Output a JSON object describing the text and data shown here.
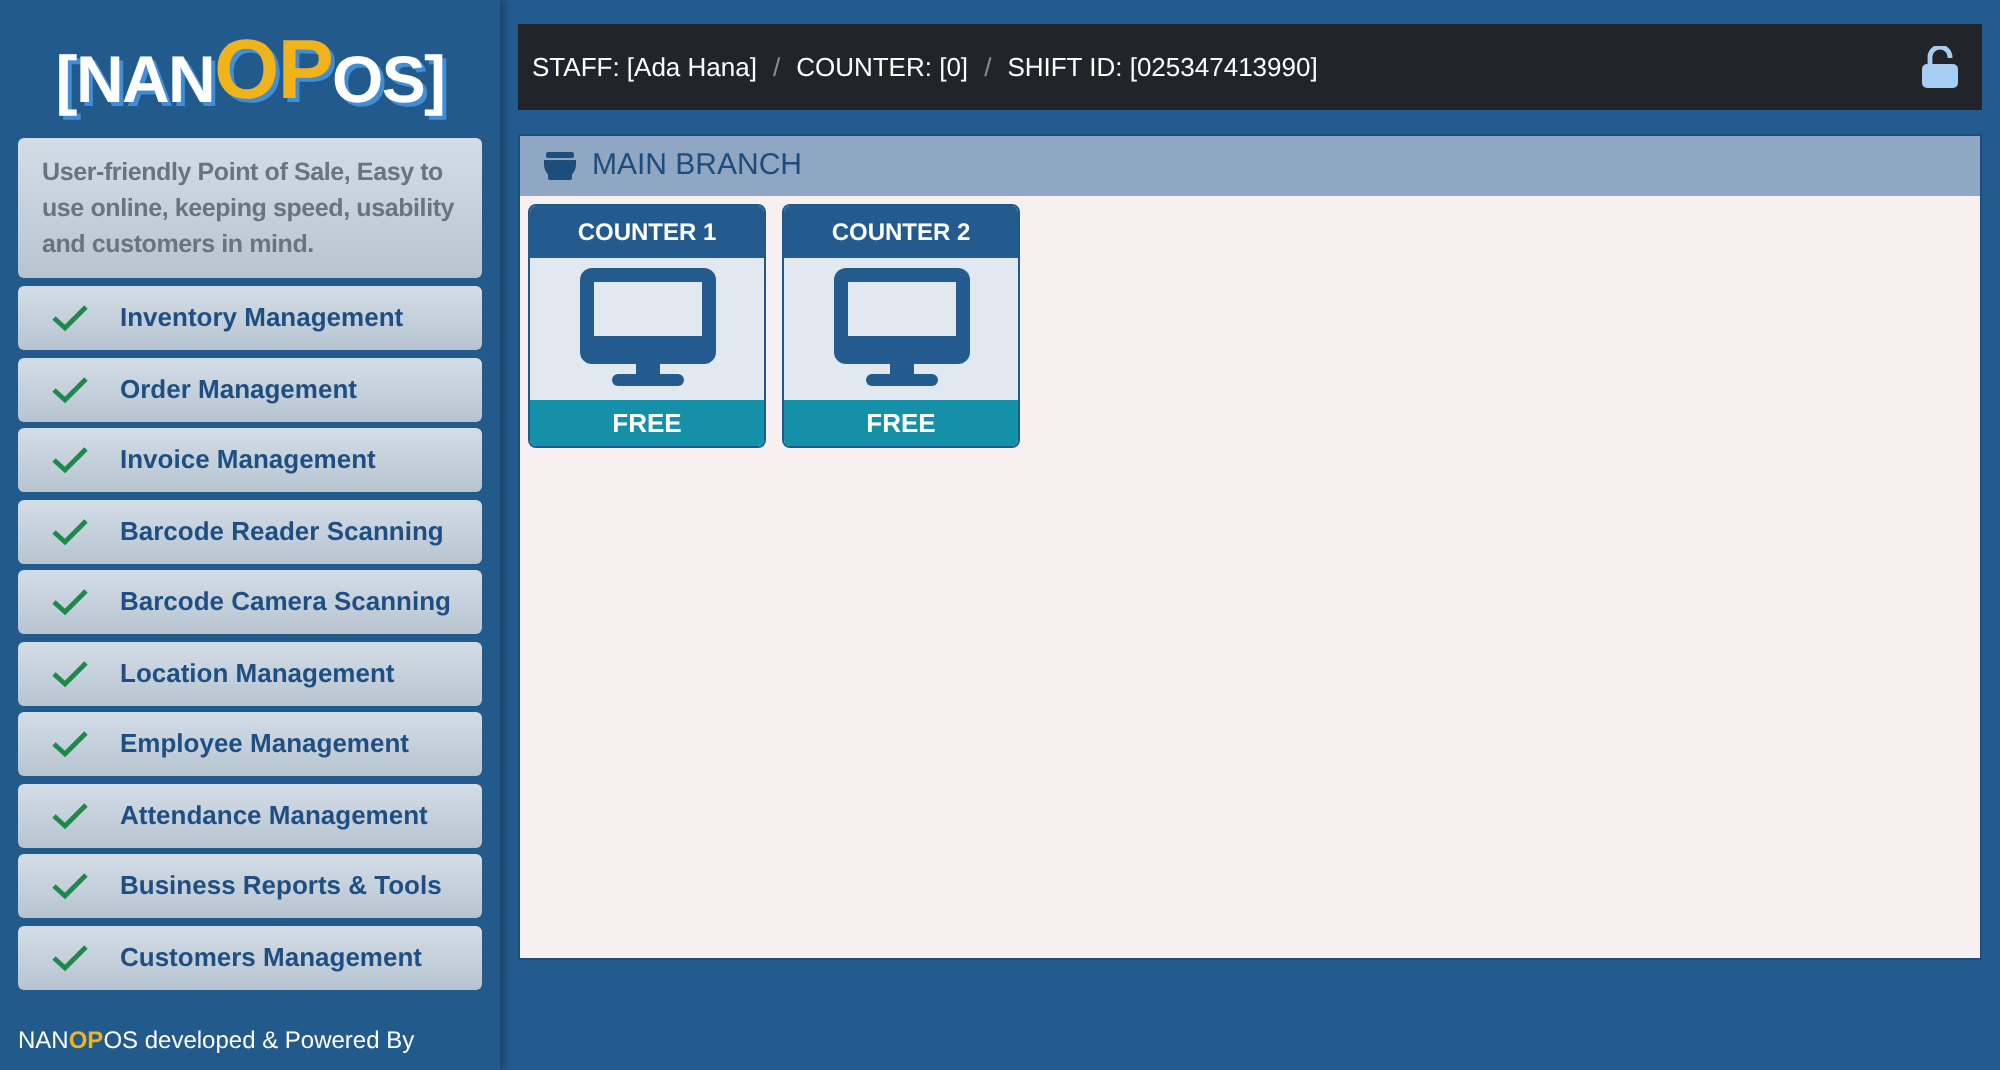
{
  "sidebar": {
    "logo": [
      {
        "text": "[NAN",
        "highlight": false
      },
      {
        "text": "OP",
        "highlight": true
      },
      {
        "text": "OS]",
        "highlight": false
      }
    ],
    "description": "User-friendly Point of Sale, Easy to use online, keeping speed, usability and customers in mind.",
    "features": [
      {
        "label": "Inventory Management",
        "checked": true
      },
      {
        "label": "Order Management",
        "checked": true
      },
      {
        "label": "Invoice Management",
        "checked": true
      },
      {
        "label": "Barcode Reader Scanning",
        "checked": true
      },
      {
        "label": "Barcode Camera Scanning",
        "checked": true
      },
      {
        "label": "Location Management",
        "checked": true
      },
      {
        "label": "Employee Management",
        "checked": true
      },
      {
        "label": "Attendance Management",
        "checked": true
      },
      {
        "label": "Business Reports & Tools",
        "checked": true
      },
      {
        "label": "Customers Management",
        "checked": true
      }
    ],
    "footer": [
      {
        "text": "NAN",
        "highlight": false
      },
      {
        "text": "OP",
        "highlight": true
      },
      {
        "text": "OS developed & Powered By",
        "highlight": false
      }
    ]
  },
  "top_bar": {
    "items": [
      {
        "kind": "info",
        "text": "STAFF: [Ada Hana]"
      },
      {
        "kind": "separator",
        "text": "/"
      },
      {
        "kind": "info",
        "text": "COUNTER: [0]"
      },
      {
        "kind": "separator",
        "text": "/"
      },
      {
        "kind": "info",
        "text": "SHIFT ID: [025347413990]"
      }
    ]
  },
  "branch": {
    "title": "MAIN BRANCH",
    "counters": [
      {
        "name": "COUNTER 1",
        "status": "FREE"
      },
      {
        "name": "COUNTER 2",
        "status": "FREE"
      }
    ]
  }
}
